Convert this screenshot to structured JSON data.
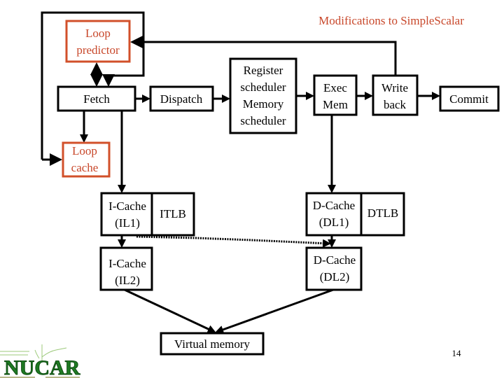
{
  "slide": {
    "title": "Modifications to SimpleScalar",
    "page_number": "14",
    "logo_text": "NUCAR",
    "accent_color": "#c8472a"
  },
  "nodes": {
    "loop_predictor": [
      "Loop",
      "predictor"
    ],
    "fetch": [
      "Fetch"
    ],
    "dispatch": [
      "Dispatch"
    ],
    "scheduler": [
      "Register",
      "scheduler",
      "Memory",
      "scheduler"
    ],
    "exec_mem": [
      "Exec",
      "Mem"
    ],
    "write_back": [
      "Write",
      "back"
    ],
    "commit": [
      "Commit"
    ],
    "loop_cache": [
      "Loop",
      "cache"
    ],
    "icache_l1": [
      "I-Cache",
      "(IL1)"
    ],
    "itlb": [
      "ITLB"
    ],
    "icache_l2": [
      "I-Cache",
      "(IL2)"
    ],
    "dcache_l1": [
      "D-Cache",
      "(DL1)"
    ],
    "dtlb": [
      "DTLB"
    ],
    "dcache_l2": [
      "D-Cache",
      "(DL2)"
    ],
    "virtual_memory": [
      "Virtual memory"
    ]
  }
}
